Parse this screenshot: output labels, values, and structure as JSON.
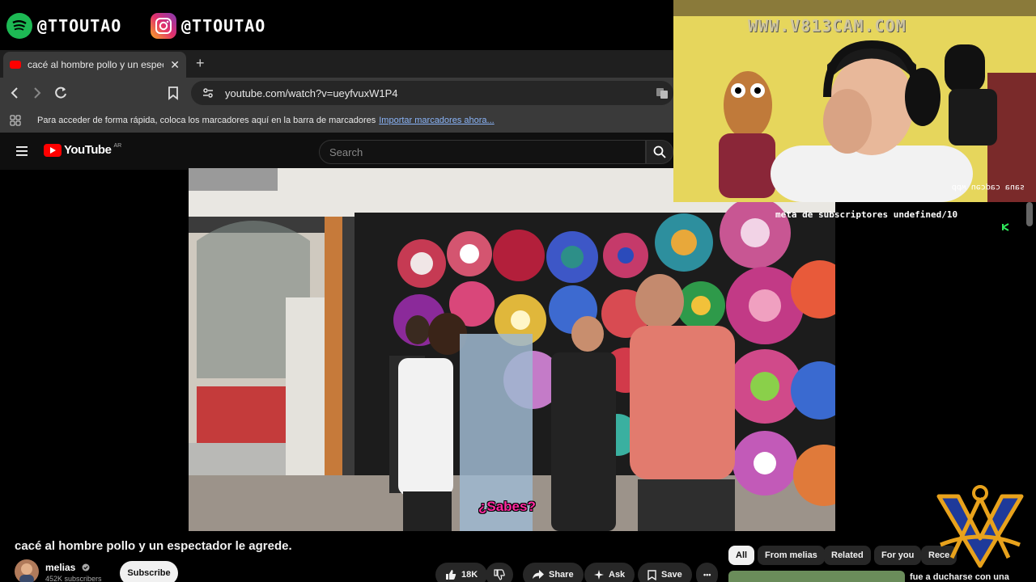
{
  "social": {
    "spotify_handle": "@TTOUTAO",
    "instagram_handle": "@TTOUTAO",
    "spotify_icon": "spotify-icon",
    "instagram_icon": "instagram-icon"
  },
  "browser": {
    "tab_title": "cacé al hombre pollo y un espect",
    "tab_close": "✕",
    "new_tab": "+",
    "url": "youtube.com/watch?v=ueyfvuxW1P4",
    "bookmarks_hint": "Para acceder de forma rápida, coloca los marcadores aquí en la barra de marcadores",
    "bookmarks_import": "Importar marcadores ahora..."
  },
  "youtube": {
    "logo_text": "YouTube",
    "logo_country": "AR",
    "search_placeholder": "Search",
    "video_subtitle": "¿Sabes?",
    "video_title": "cacé al hombre pollo y un espectador le agrede.",
    "channel_name": "melias",
    "channel_subs": "452K subscribers",
    "subscribe_label": "Subscribe",
    "likes": "18K",
    "share_label": "Share",
    "ask_label": "Ask",
    "save_label": "Save",
    "more_label": "•••",
    "chips": [
      "All",
      "From melias",
      "Related",
      "For you",
      "Rece"
    ],
    "rec_title": "fue a ducharse con una"
  },
  "overlay": {
    "cam_watermark": "WWW.V813CAM.COM",
    "cam_caption": "ddw ueɔpɐɔ ɐuɐs",
    "sub_goal": "meta de subscriptores undefined/10"
  },
  "colors": {
    "youtube_red": "#ff0000",
    "spotify_green": "#1db954",
    "subtitle_pink": "#ff2aa0",
    "emblem_gold": "#e8a21c",
    "emblem_blue": "#1f3a9a"
  }
}
